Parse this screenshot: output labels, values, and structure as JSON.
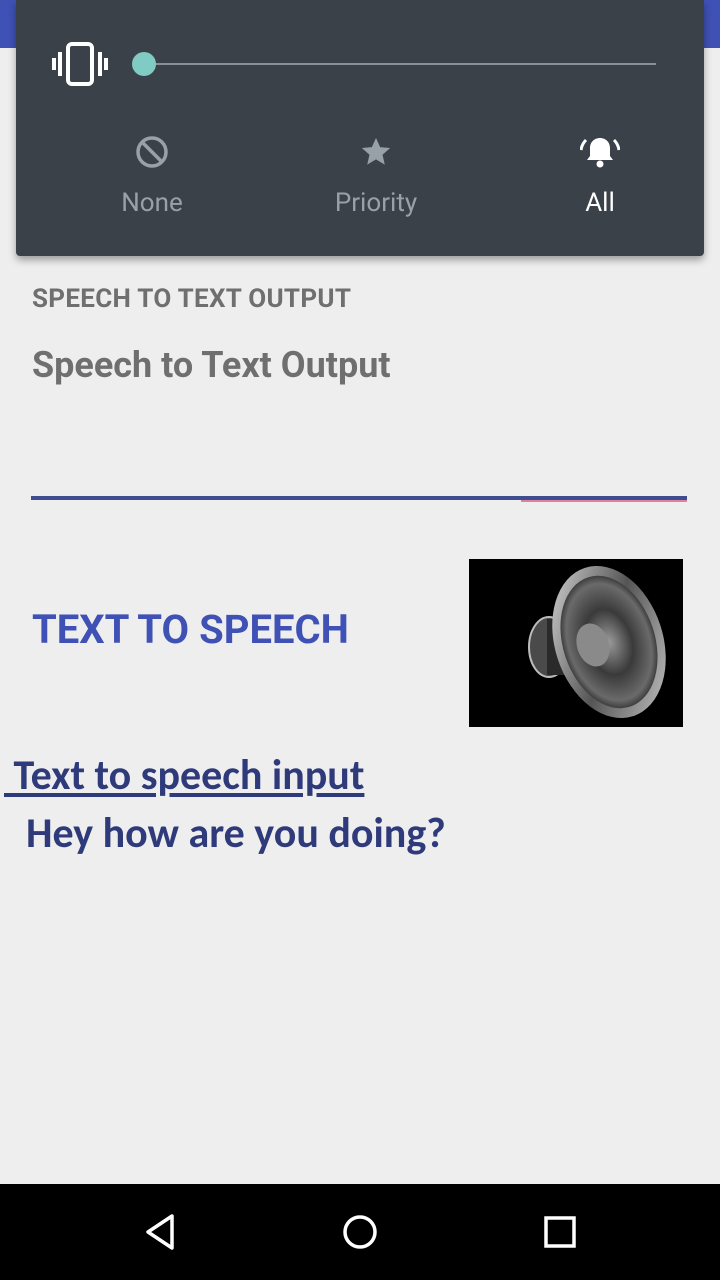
{
  "volume_panel": {
    "ringer_mode_icon": "vibrate-icon",
    "volume_level": 0,
    "accent_color": "#80cbc4",
    "modes": [
      {
        "label": "None",
        "icon": "do-not-disturb-icon",
        "active": false
      },
      {
        "label": "Priority",
        "icon": "star-icon",
        "active": false
      },
      {
        "label": "All",
        "icon": "bell-ringing-icon",
        "active": true
      }
    ]
  },
  "speech_to_text": {
    "section_label": "SPEECH TO TEXT OUTPUT",
    "output_text": "Speech to Text Output"
  },
  "text_to_speech": {
    "button_label": "TEXT TO SPEECH",
    "speaker_image": "speaker-icon",
    "input_label": " Text to speech input",
    "input_text": "Hey how are you doing?"
  },
  "colors": {
    "primary": "#3f51b5",
    "panel_bg": "#3a4148",
    "text_dark_blue": "#2f3a7a"
  },
  "navigation": {
    "back": "back-icon",
    "home": "home-icon",
    "recents": "recents-icon"
  }
}
